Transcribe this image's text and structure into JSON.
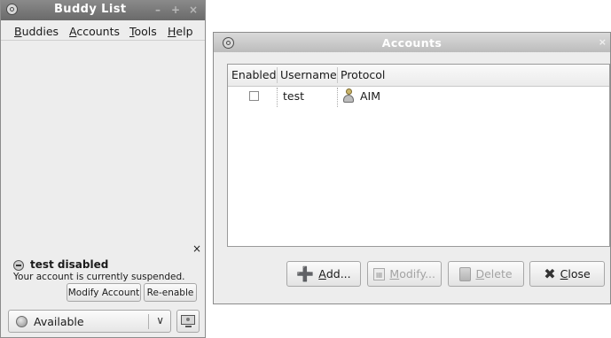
{
  "buddy_window": {
    "title": "Buddy List",
    "menu": [
      {
        "label": "Buddies",
        "mnemonic": "B",
        "rest": "uddies"
      },
      {
        "label": "Accounts",
        "mnemonic": "A",
        "rest": "ccounts"
      },
      {
        "label": "Tools",
        "mnemonic": "T",
        "rest": "ools"
      },
      {
        "label": "Help",
        "mnemonic": "H",
        "rest": "elp"
      }
    ],
    "notice": {
      "title": "test disabled",
      "message": "Your account is currently suspended.",
      "modify_button": "Modify Account",
      "reenable_button": "Re-enable"
    },
    "status": {
      "label": "Available"
    }
  },
  "accounts_window": {
    "title": "Accounts",
    "columns": [
      "Enabled",
      "Username",
      "Protocol"
    ],
    "rows": [
      {
        "enabled": false,
        "username": "test",
        "protocol": "AIM",
        "protocol_icon": "aim-buddy-icon"
      }
    ],
    "buttons": {
      "add": {
        "mnemonic": "A",
        "rest": "dd..."
      },
      "modify": {
        "mnemonic": "M",
        "rest": "odify..."
      },
      "delete": {
        "mnemonic": "D",
        "rest": "elete"
      },
      "close": {
        "mnemonic": "C",
        "rest": "lose"
      }
    }
  },
  "colors": {
    "window_bg": "#ededed",
    "titlebar_active": "#7a7a7a",
    "titlebar_inactive": "#cacaca",
    "disabled_text": "#a3a3a3"
  }
}
